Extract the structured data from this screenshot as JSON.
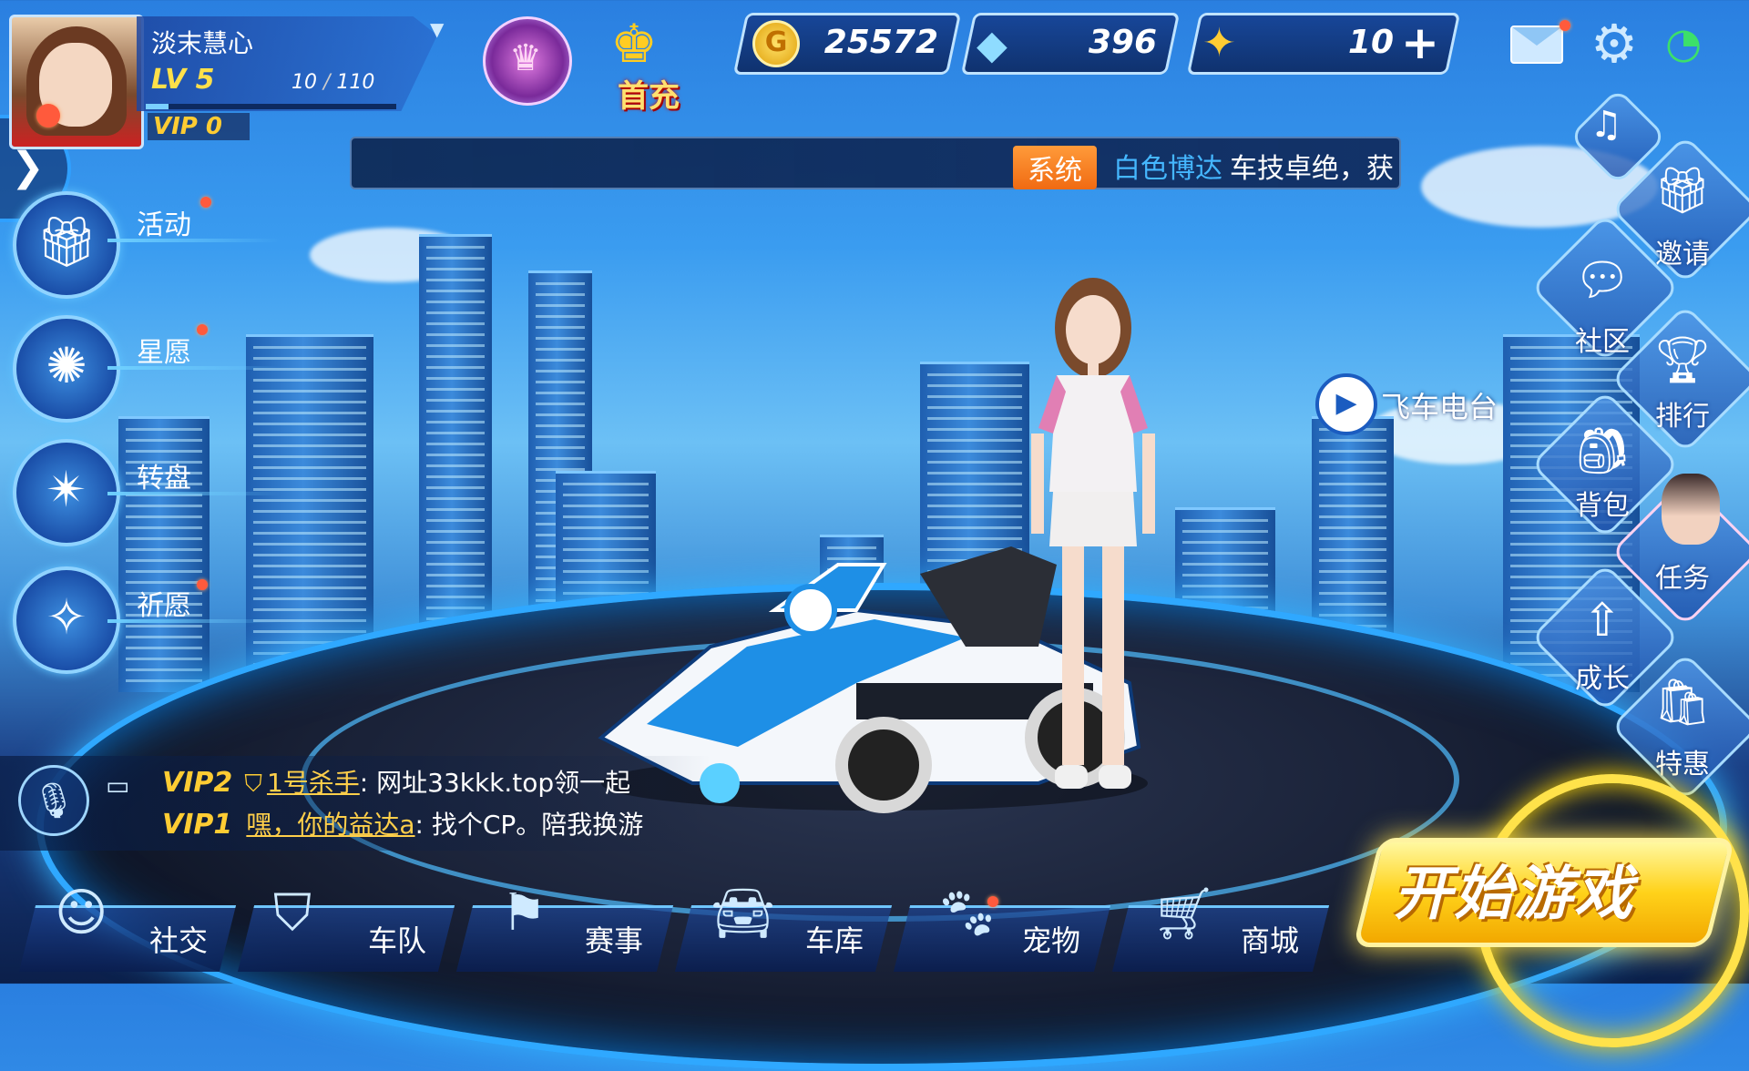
{
  "player": {
    "name": "淡末慧心",
    "level": "LV 5",
    "exp_current": "10",
    "exp_sep": " / ",
    "exp_max": "110",
    "exp_fraction": 0.09,
    "vip": "VIP 0"
  },
  "badges": {
    "first_charge": "首充"
  },
  "resources": {
    "gold": "25572",
    "gold_icon": "G",
    "diamonds": "396",
    "tickets": "10"
  },
  "broadcast": {
    "tag": "系统",
    "user": "白色博达",
    "text": "车技卓绝，获"
  },
  "left_menu": [
    {
      "label": "活动",
      "icon": "gift-icon"
    },
    {
      "label": "星愿",
      "icon": "star-wish-icon"
    },
    {
      "label": "转盘",
      "icon": "wheel-icon"
    },
    {
      "label": "祈愿",
      "icon": "magic-wand-icon"
    }
  ],
  "right_menu": {
    "invite": "邀请",
    "community": "社区",
    "ranking": "排行",
    "backpack": "背包",
    "task": "任务",
    "growth": "成长",
    "special": "特惠"
  },
  "radio": {
    "label": "飞车电台"
  },
  "chat": [
    {
      "vip": "VIP2",
      "user": "1号杀手",
      "message": "网址33kkk.top领一起"
    },
    {
      "vip": "VIP1",
      "user": "嘿，你的益达a",
      "message": "找个CP。陪我换游"
    }
  ],
  "chat_separator": ": ",
  "bottom_nav": [
    {
      "label": "社交",
      "icon": "social-icon"
    },
    {
      "label": "车队",
      "icon": "team-icon"
    },
    {
      "label": "赛事",
      "icon": "race-flag-icon"
    },
    {
      "label": "车库",
      "icon": "garage-car-icon"
    },
    {
      "label": "宠物",
      "icon": "pet-paw-icon"
    },
    {
      "label": "商城",
      "icon": "shop-cart-icon"
    }
  ],
  "start_button": "开始游戏",
  "colors": {
    "accent": "#2fa8ff",
    "gold": "#ffcc33",
    "system_tag": "#f06a12",
    "broadcast_user": "#45b7ff"
  }
}
